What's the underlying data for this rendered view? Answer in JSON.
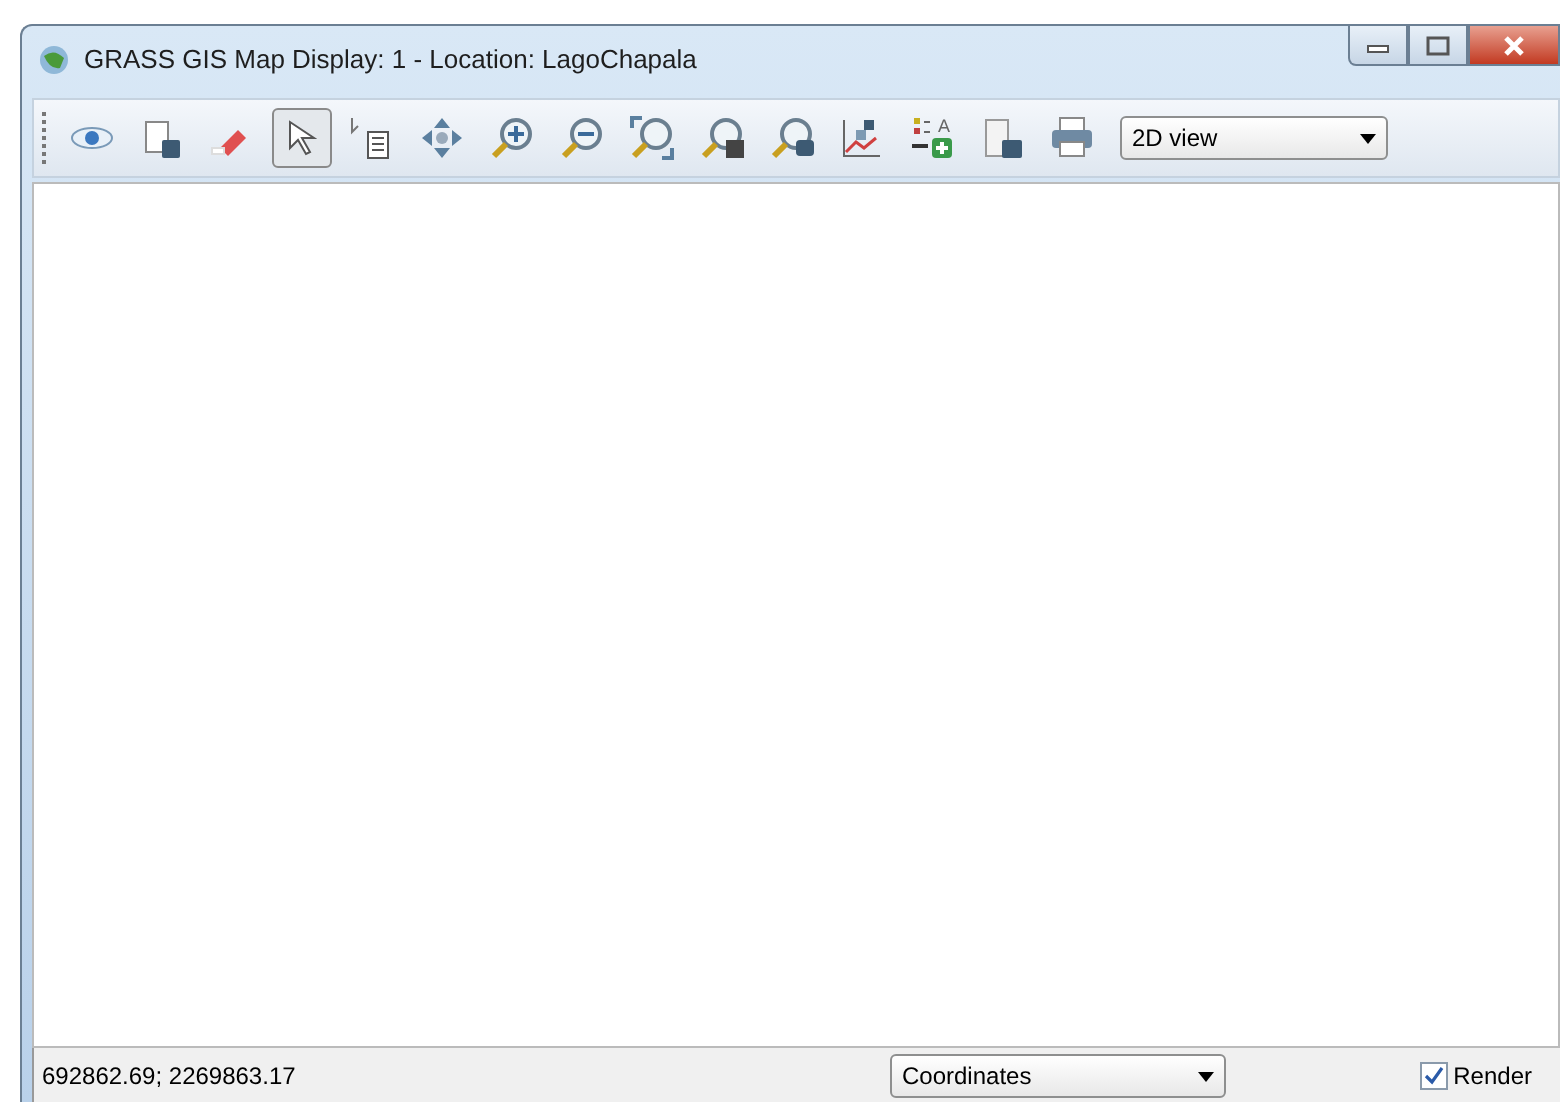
{
  "window": {
    "title": "GRASS GIS Map Display: 1  - Location: LagoChapala"
  },
  "toolbar": {
    "tools": [
      {
        "kind": "display",
        "selected": false
      },
      {
        "kind": "render",
        "selected": false
      },
      {
        "kind": "erase",
        "selected": false
      },
      {
        "kind": "pointer",
        "selected": true
      },
      {
        "kind": "query",
        "selected": false
      },
      {
        "kind": "pan",
        "selected": false
      },
      {
        "kind": "zoom-in",
        "selected": false
      },
      {
        "kind": "zoom-out",
        "selected": false
      },
      {
        "kind": "zoom-extent",
        "selected": false
      },
      {
        "kind": "zoom-back",
        "selected": false
      },
      {
        "kind": "zoom-menu",
        "selected": false
      },
      {
        "kind": "analyze",
        "selected": false
      },
      {
        "kind": "decoration",
        "selected": false,
        "glyph": "A"
      },
      {
        "kind": "save",
        "selected": false
      },
      {
        "kind": "print",
        "selected": false
      }
    ],
    "view_select": {
      "value": "2D view"
    }
  },
  "status_bar": {
    "coordinates": "692862.69; 2269863.17",
    "mode_select": {
      "value": "Coordinates"
    },
    "render": {
      "label": "Render",
      "checked": true
    }
  }
}
